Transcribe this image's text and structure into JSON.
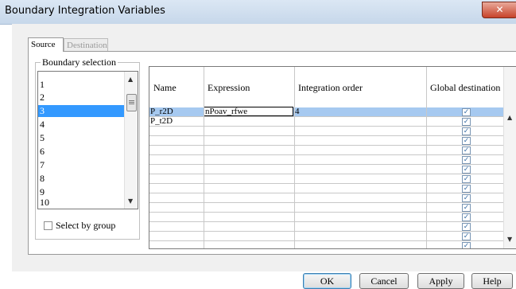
{
  "window": {
    "title": "Boundary Integration Variables"
  },
  "tabs": [
    {
      "label": "Source",
      "active": true
    },
    {
      "label": "Destination",
      "active": false
    }
  ],
  "boundary_selection": {
    "label": "Boundary selection",
    "items": [
      "1",
      "2",
      "3",
      "4",
      "5",
      "6",
      "7",
      "8",
      "9",
      "10"
    ],
    "selected": "3"
  },
  "select_by_group": {
    "label": "Select by group",
    "checked": false
  },
  "grid": {
    "columns": [
      "Name",
      "Expression",
      "Integration order",
      "Global destination"
    ],
    "rows": [
      {
        "name": "P_r2D",
        "expression": "nPoav_rfwe",
        "order": "4",
        "global": true
      },
      {
        "name": "P_t2D",
        "expression": "",
        "order": "",
        "global": true
      },
      {
        "name": "",
        "expression": "",
        "order": "",
        "global": true
      },
      {
        "name": "",
        "expression": "",
        "order": "",
        "global": true
      },
      {
        "name": "",
        "expression": "",
        "order": "",
        "global": true
      },
      {
        "name": "",
        "expression": "",
        "order": "",
        "global": true
      },
      {
        "name": "",
        "expression": "",
        "order": "",
        "global": true
      },
      {
        "name": "",
        "expression": "",
        "order": "",
        "global": true
      },
      {
        "name": "",
        "expression": "",
        "order": "",
        "global": true
      },
      {
        "name": "",
        "expression": "",
        "order": "",
        "global": true
      },
      {
        "name": "",
        "expression": "",
        "order": "",
        "global": true
      },
      {
        "name": "",
        "expression": "",
        "order": "",
        "global": true
      },
      {
        "name": "",
        "expression": "",
        "order": "",
        "global": true
      },
      {
        "name": "",
        "expression": "",
        "order": "",
        "global": true
      },
      {
        "name": "",
        "expression": "",
        "order": "",
        "global": true
      }
    ]
  },
  "buttons": {
    "ok": "OK",
    "cancel": "Cancel",
    "apply": "Apply",
    "help": "Help"
  },
  "colors": {
    "selection": "#3399ff",
    "row_selection": "#a6c9f0",
    "close_button": "#c7432a"
  }
}
